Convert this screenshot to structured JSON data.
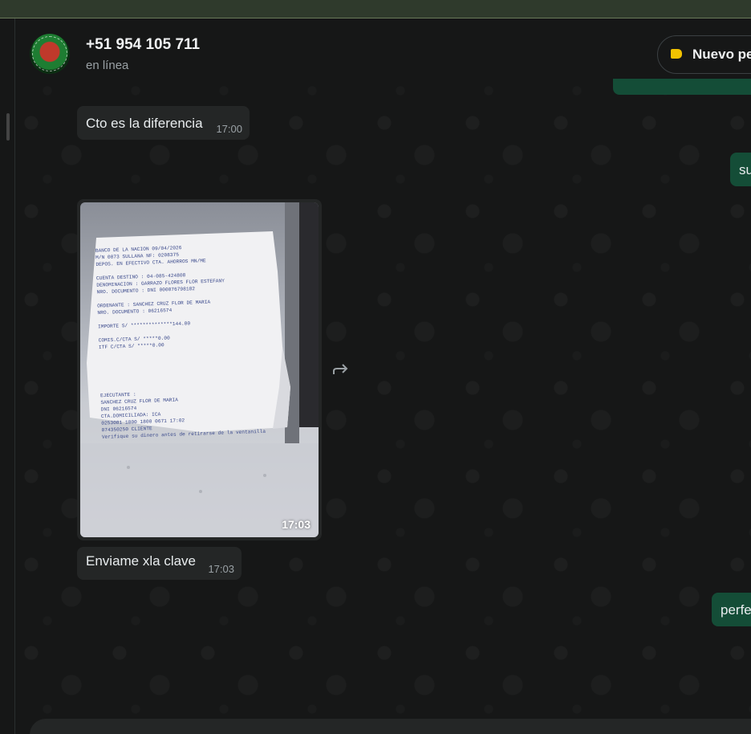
{
  "contact": {
    "name": "+51 954 105 711",
    "status": "en línea"
  },
  "header": {
    "new_order_label": "Nuevo pe"
  },
  "messages": {
    "m1": {
      "text": "Cto es la diferencia",
      "time": "17:00"
    },
    "image": {
      "time": "17:03"
    },
    "m3": {
      "text": "Enviame xla clave",
      "time": "17:03"
    },
    "out_su": {
      "text": "su"
    },
    "out_perf": {
      "text": "perfe"
    }
  },
  "receipt": {
    "lines": [
      "BANCO DE LA NACION                   09/04/2026",
      "M/N     0073 SULLANA               NF: 0208375",
      "DEPOS. EN EFECTIVO CTA. AHORROS MN/ME",
      "",
      "CUENTA DESTINO : 04-085-424808",
      "DENOMINACION   : GARRAZO FLORES FLOR ESTEFANY",
      "NRO. DOCUMENTO : DNI          000076798182",
      "",
      "ORDENANTE      : SANCHEZ CRUZ FLOR DE MARIA",
      "NRO. DOCUMENTO : 06216574",
      "",
      "IMPORTE     S/ **************144.00",
      "",
      "COMIS.C/CTA  S/               *****0.00",
      "ITF C/CTA    S/ *****0.00",
      "",
      "",
      "",
      "",
      "",
      "",
      "EJECUTANTE :",
      "SANCHEZ CRUZ FLOR DE MARIA",
      " DNI              06216574",
      "CTA.DOMICILIADA: ICA",
      "0253081  1800    1800     0671    17:02",
      "074350250                              CLIENTE",
      "Verifique su dinero antes de retirarse de la ventanilla"
    ]
  },
  "colors": {
    "incoming_bubble": "#242626",
    "outgoing_bubble": "#144d37",
    "tag_icon": "#f2c200"
  }
}
